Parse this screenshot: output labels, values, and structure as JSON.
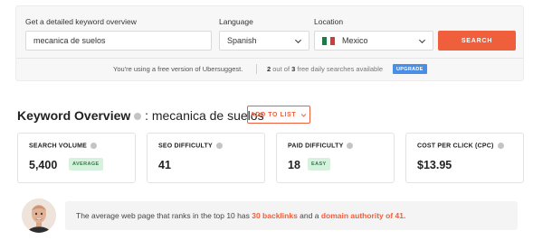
{
  "search": {
    "keyword_label": "Get a detailed keyword overview",
    "keyword_value": "mecanica de suelos",
    "language_label": "Language",
    "language_value": "Spanish",
    "location_label": "Location",
    "location_value": "Mexico",
    "search_button": "SEARCH"
  },
  "free_notice": {
    "message": "You're using a free version of Ubersuggest.",
    "used": "2",
    "of_text": "out of",
    "total": "3",
    "rest": "free daily searches available",
    "upgrade_button": "UPGRADE"
  },
  "overview": {
    "title": "Keyword Overview",
    "keyword": ": mecanica de suelos",
    "add_to_list": "ADD TO LIST"
  },
  "metrics": [
    {
      "label": "SEARCH VOLUME",
      "value": "5,400",
      "badge": "AVERAGE"
    },
    {
      "label": "SEO DIFFICULTY",
      "value": "41"
    },
    {
      "label": "PAID DIFFICULTY",
      "value": "18",
      "badge": "EASY"
    },
    {
      "label": "COST PER CLICK (CPC)",
      "value": "$13.95"
    }
  ],
  "tip": {
    "prefix": "The average web page that ranks in the top 10 has",
    "backlinks": "30 backlinks",
    "middle": "and a",
    "authority": "domain authority of 41."
  },
  "colors": {
    "accent": "#f05f3c",
    "upgrade": "#4a8fe7",
    "badge_bg": "#d6f1dd",
    "badge_text": "#2e7d47"
  },
  "icons": [
    "chevron-down-icon",
    "mexico-flag-icon",
    "info-icon",
    "avatar"
  ]
}
